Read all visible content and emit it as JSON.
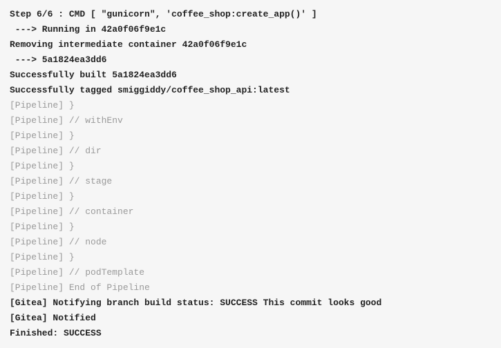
{
  "lines": [
    {
      "text": "Step 6/6 : CMD [ \"gunicorn\", 'coffee_shop:create_app()' ]",
      "style": "bold"
    },
    {
      "text": " ---> Running in 42a0f06f9e1c",
      "style": "bold"
    },
    {
      "text": "Removing intermediate container 42a0f06f9e1c",
      "style": "bold"
    },
    {
      "text": " ---> 5a1824ea3dd6",
      "style": "bold"
    },
    {
      "text": "Successfully built 5a1824ea3dd6",
      "style": "bold"
    },
    {
      "text": "Successfully tagged smiggiddy/coffee_shop_api:latest",
      "style": "bold"
    },
    {
      "text": "[Pipeline] }",
      "style": "dim"
    },
    {
      "text": "[Pipeline] // withEnv",
      "style": "dim"
    },
    {
      "text": "[Pipeline] }",
      "style": "dim"
    },
    {
      "text": "[Pipeline] // dir",
      "style": "dim"
    },
    {
      "text": "[Pipeline] }",
      "style": "dim"
    },
    {
      "text": "[Pipeline] // stage",
      "style": "dim"
    },
    {
      "text": "[Pipeline] }",
      "style": "dim"
    },
    {
      "text": "[Pipeline] // container",
      "style": "dim"
    },
    {
      "text": "[Pipeline] }",
      "style": "dim"
    },
    {
      "text": "[Pipeline] // node",
      "style": "dim"
    },
    {
      "text": "[Pipeline] }",
      "style": "dim"
    },
    {
      "text": "[Pipeline] // podTemplate",
      "style": "dim"
    },
    {
      "text": "[Pipeline] End of Pipeline",
      "style": "dim"
    },
    {
      "text": "[Gitea] Notifying branch build status: SUCCESS This commit looks good",
      "style": "bold"
    },
    {
      "text": "[Gitea] Notified",
      "style": "bold"
    },
    {
      "text": "Finished: SUCCESS",
      "style": "bold"
    }
  ]
}
